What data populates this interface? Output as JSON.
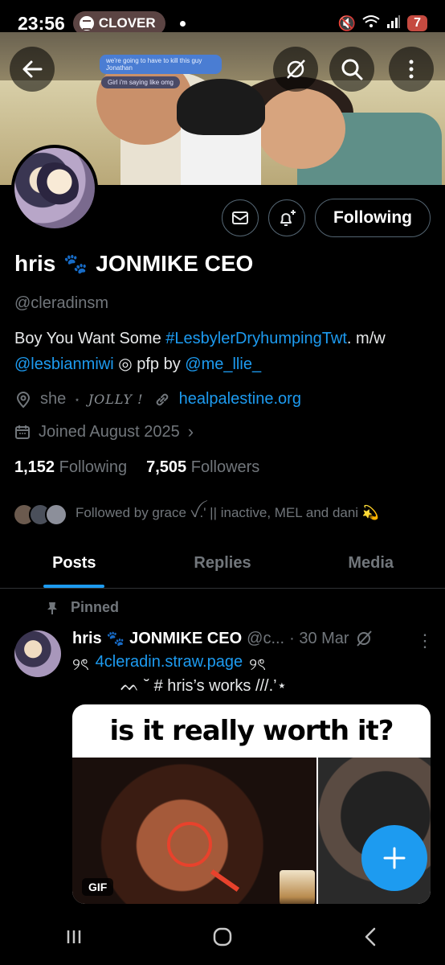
{
  "status": {
    "time": "23:56",
    "app_pill": "CLOVER",
    "battery": "7"
  },
  "banner": {
    "chat_top": "we're going to have to kill this guy Jonathan",
    "chat_bottom": "Girl i'm saying like omg"
  },
  "profile": {
    "name_left": "hris",
    "name_right": "JONMIKE CEO",
    "handle": "@cleradinsm",
    "bio_prefix": "Boy You Want Some ",
    "bio_hashtag": "#LesbylerDryhumpingTwt",
    "bio_mid": ".  m/w",
    "bio_mention1": "@lesbianmiwi",
    "bio_pfp": " ◎ pfp by ",
    "bio_mention2": "@me_llie_",
    "pronoun": "she",
    "jolly": "JOLLY !",
    "website": "healpalestine.org",
    "joined": "Joined August 2025",
    "following_count": "1,152",
    "following_label": "Following",
    "followers_count": "7,505",
    "followers_label": "Followers",
    "followed_by": "Followed by grace ꪜ.' || inactive, MEL and dani 💫",
    "follow_button": "Following"
  },
  "tabs": [
    "Posts",
    "Replies",
    "Media"
  ],
  "post": {
    "pinned_label": "Pinned",
    "author_name": "hris",
    "author_rest": "JONMIKE CEO",
    "handle_trunc": "@c...",
    "date": "· 30 Mar",
    "link_line": "4cleradin.straw.page",
    "deco_left": "୨ৎ",
    "deco_right": "୨ৎ",
    "line2": "ᨓ ˘  # hris’s works  ///.’⋆",
    "media_title": "is it really worth it?",
    "gif_label": "GIF"
  },
  "colors": {
    "accent": "#1d9bf0",
    "muted": "#71767b",
    "background": "#000000"
  },
  "icons": {
    "back": "back-arrow-icon",
    "grok": "grok-icon",
    "search": "search-icon",
    "more": "more-vertical-icon",
    "message": "envelope-icon",
    "notify": "bell-plus-icon",
    "location": "location-pin-icon",
    "link": "link-icon",
    "calendar": "calendar-icon",
    "pin": "pin-icon",
    "compose": "plus-icon"
  }
}
